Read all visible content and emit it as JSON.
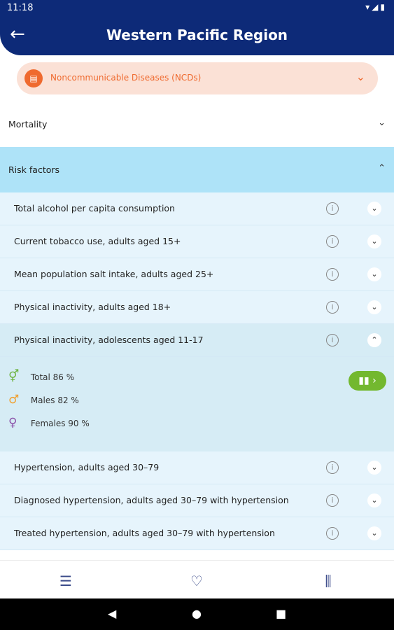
{
  "status": {
    "time": "11:18",
    "icons": "▾◢▮"
  },
  "header": {
    "back_icon": "←",
    "title": "Western Pacific Region"
  },
  "filter": {
    "icon": "▤",
    "label": "Noncommunicable Diseases (NCDs)",
    "chevron": "⌄"
  },
  "sections": {
    "mortality": {
      "label": "Mortality",
      "chevron": "⌄"
    },
    "risk": {
      "label": "Risk factors",
      "chevron": "⌃"
    }
  },
  "rows": [
    {
      "label": "Total alcohol per capita consumption",
      "info": "i",
      "chevron": "⌄"
    },
    {
      "label": "Current tobacco use, adults aged 15+",
      "info": "i",
      "chevron": "⌄"
    },
    {
      "label": "Mean population salt intake, adults aged 25+",
      "info": "i",
      "chevron": "⌄"
    },
    {
      "label": "Physical inactivity, adults aged 18+",
      "info": "i",
      "chevron": "⌄"
    },
    {
      "label": "Physical inactivity, adolescents aged 11-17",
      "info": "i",
      "chevron": "⌃"
    },
    {
      "label": "Hypertension, adults aged 30–79",
      "info": "i",
      "chevron": "⌄"
    },
    {
      "label": "Diagnosed hypertension, adults aged 30–79 with hypertension",
      "info": "i",
      "chevron": "⌄"
    },
    {
      "label": "Treated hypertension, adults aged 30–79 with hypertension",
      "info": "i",
      "chevron": "⌄"
    }
  ],
  "detail": {
    "total": {
      "symbol": "⚥",
      "text": "Total 86  %"
    },
    "males": {
      "symbol": "♂",
      "text": "Males 82  %"
    },
    "females": {
      "symbol": "♀",
      "text": "Females 90  %"
    },
    "chart_button": "▮▮ ›"
  },
  "bottom_nav": {
    "menu_icon": "☰",
    "favorite_icon": "♡",
    "library_icon": "⫼"
  },
  "system_nav": {
    "back": "◀",
    "home": "●",
    "recent": "■"
  },
  "colors": {
    "header": "#0d2a78",
    "accent": "#ef6a2f",
    "risk_bg": "#aee3f8",
    "green": "#73b82f"
  }
}
